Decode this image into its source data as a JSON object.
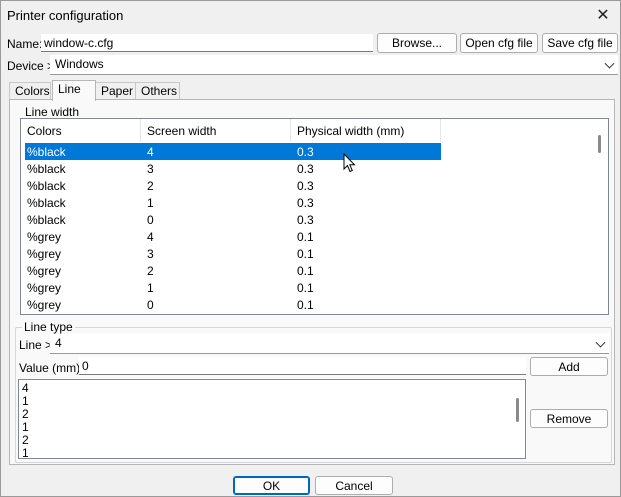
{
  "window": {
    "title": "Printer configuration"
  },
  "name_row": {
    "label": "Name:",
    "value": "window-c.cfg",
    "browse_label": "Browse...",
    "open_label": "Open cfg file",
    "save_label": "Save cfg file"
  },
  "device_row": {
    "label": "Device >",
    "selected": "Windows"
  },
  "tabs": [
    {
      "label": "Colors"
    },
    {
      "label": "Line"
    },
    {
      "label": "Paper"
    },
    {
      "label": "Others"
    }
  ],
  "line_width": {
    "group_title": "Line width",
    "columns": [
      "Colors",
      "Screen width",
      "Physical width (mm)"
    ],
    "rows": [
      {
        "color": "%black",
        "screen": "4",
        "physical": "0.3"
      },
      {
        "color": "%black",
        "screen": "3",
        "physical": "0.3"
      },
      {
        "color": "%black",
        "screen": "2",
        "physical": "0.3"
      },
      {
        "color": "%black",
        "screen": "1",
        "physical": "0.3"
      },
      {
        "color": "%black",
        "screen": "0",
        "physical": "0.3"
      },
      {
        "color": "%grey",
        "screen": "4",
        "physical": "0.1"
      },
      {
        "color": "%grey",
        "screen": "3",
        "physical": "0.1"
      },
      {
        "color": "%grey",
        "screen": "2",
        "physical": "0.1"
      },
      {
        "color": "%grey",
        "screen": "1",
        "physical": "0.1"
      },
      {
        "color": "%grey",
        "screen": "0",
        "physical": "0.1"
      }
    ],
    "selected_index": 0
  },
  "line_type": {
    "group_title": "Line type",
    "line_label": "Line >",
    "line_selected": "4",
    "value_label": "Value (mm):",
    "value": "0",
    "add_label": "Add",
    "remove_label": "Remove",
    "items": [
      "4",
      "1",
      "2",
      "1",
      "2",
      "1"
    ]
  },
  "footer": {
    "ok_label": "OK",
    "cancel_label": "Cancel"
  },
  "colors": {
    "selection": "#0078d7",
    "default_border": "#0067c0"
  }
}
